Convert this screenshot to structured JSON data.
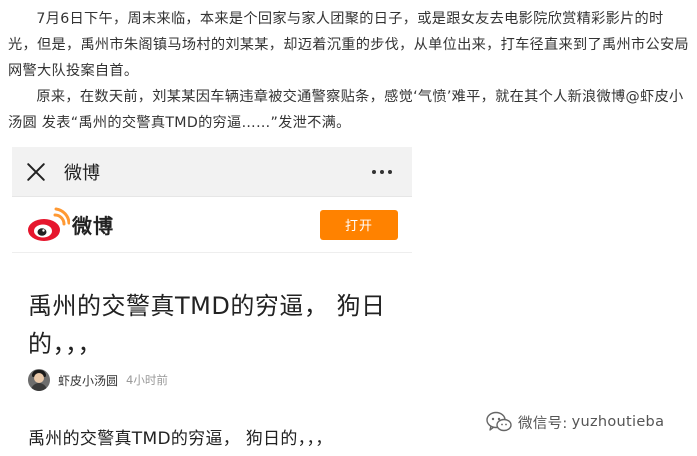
{
  "article": {
    "paragraph1": "7月6日下午，周末来临，本来是个回家与家人团聚的日子，或是跟女友去电影院欣赏精彩影片的时光，但是，禹州市朱阁镇马场村的刘某某，却迈着沉重的步伐，从单位出来，打车径直来到了禹州市公安局网警大队投案自首。",
    "paragraph2": "原来，在数天前，刘某某因车辆违章被交通警察贴条，感觉‘气愤’难平，就在其个人新浪微博@虾皮小汤圆 发表“禹州的交警真TMD的穷逼……”发泄不满。"
  },
  "phone_screenshot": {
    "topbar_title": "微博",
    "brand_name": "微博",
    "open_button": "打开",
    "post_title": "禹州的交警真TMD的穷逼， 狗日的，，，",
    "author_name": "虾皮小汤圆",
    "post_time": "4小时前",
    "post_body": "禹州的交警真TMD的穷逼， 狗日的，，，",
    "icons": [
      "close-icon",
      "more-icon",
      "weibo-logo-icon"
    ],
    "colors": {
      "open_button": "#ff8200",
      "logo_red": "#e6162d",
      "logo_orange": "#ff9933"
    }
  },
  "watermark": {
    "label": "微信号:",
    "handle": "yuzhoutieba",
    "icon": "wechat-icon"
  }
}
